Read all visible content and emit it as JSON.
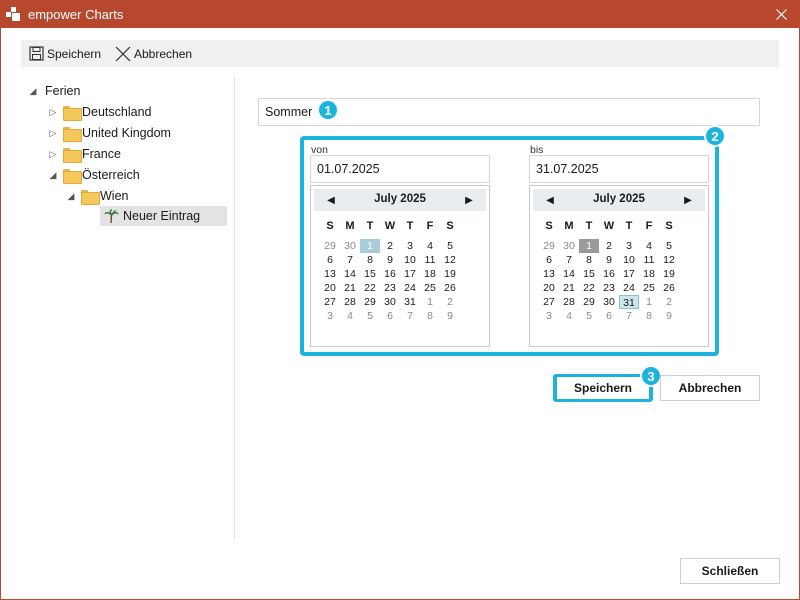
{
  "window": {
    "title": "empower Charts"
  },
  "toolbar": {
    "save_label": "Speichern",
    "cancel_label": "Abbrechen"
  },
  "tree": {
    "root": "Ferien",
    "items": [
      "Deutschland",
      "United Kingdom",
      "France",
      "Österreich"
    ],
    "sub": "Wien",
    "leaf": "Neuer Eintrag"
  },
  "form": {
    "name_value": "Sommer",
    "from_label": "von",
    "from_value": "01.07.2025",
    "to_label": "bis",
    "to_value": "31.07.2025",
    "badges": [
      "1",
      "2",
      "3"
    ]
  },
  "calendar": {
    "month_title": "July 2025",
    "weekdays": [
      "S",
      "M",
      "T",
      "W",
      "T",
      "F",
      "S"
    ],
    "weeks": [
      [
        "29",
        "30",
        "1",
        "2",
        "3",
        "4",
        "5"
      ],
      [
        "6",
        "7",
        "8",
        "9",
        "10",
        "11",
        "12"
      ],
      [
        "13",
        "14",
        "15",
        "16",
        "17",
        "18",
        "19"
      ],
      [
        "20",
        "21",
        "22",
        "23",
        "24",
        "25",
        "26"
      ],
      [
        "27",
        "28",
        "29",
        "30",
        "31",
        "1",
        "2"
      ],
      [
        "3",
        "4",
        "5",
        "6",
        "7",
        "8",
        "9"
      ]
    ]
  },
  "actions": {
    "save_label": "Speichern",
    "cancel_label": "Abbrechen",
    "close_label": "Schließen"
  },
  "colors": {
    "titlebar": "#b8482d",
    "highlight": "#1cb4dc"
  }
}
